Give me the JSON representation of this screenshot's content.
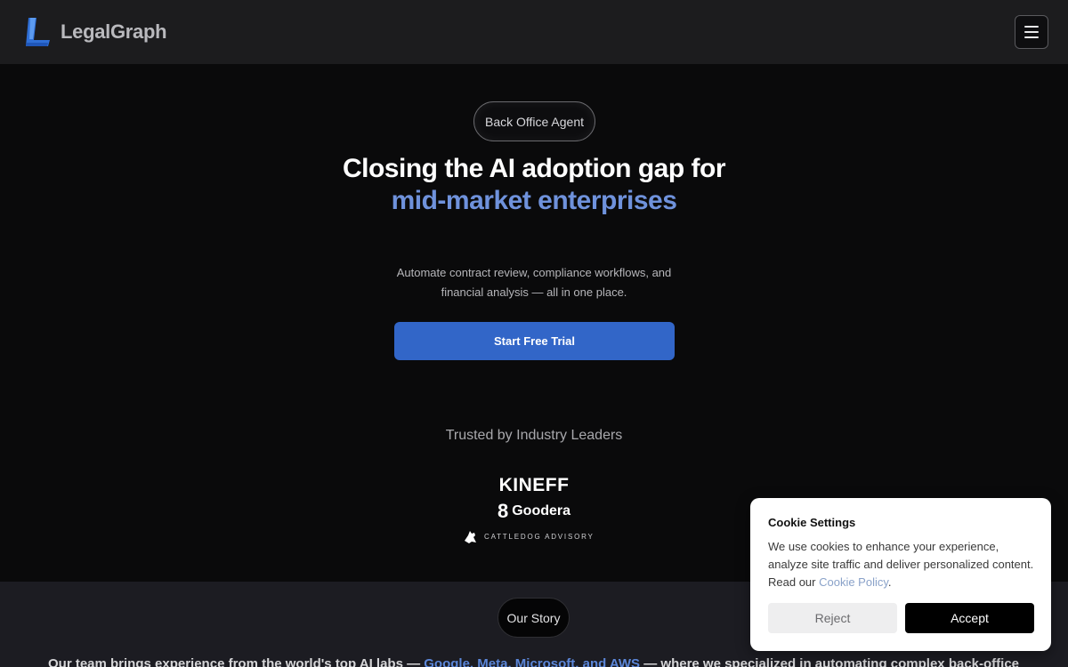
{
  "header": {
    "brand_name": "LegalGraph",
    "logo_icon": "legalgraph-logo-icon",
    "menu_icon": "hamburger-menu-icon"
  },
  "hero": {
    "badge_label": "Back Office Agent",
    "headline_line1": "Closing the AI adoption gap for",
    "headline_line2": "mid-market enterprises",
    "subtext": "Automate contract review, compliance workflows, and financial analysis — all in one place.",
    "cta_label": "Start Free Trial",
    "trusted_heading": "Trusted by Industry Leaders",
    "client_logos": {
      "kineff": "KINEFF",
      "goodera": "Goodera",
      "cattledog": "CATTLEDOG ADVISORY"
    }
  },
  "story": {
    "badge_label": "Our Story",
    "text_before": "Our team brings experience from the world's top AI labs — ",
    "text_link": "Google, Meta, Microsoft, and AWS",
    "text_after": " — where we specialized in automating complex back-office"
  },
  "cookie": {
    "title": "Cookie Settings",
    "body_before": "We use cookies to enhance your experience, analyze site traffic and deliver personalized content. Read our ",
    "policy_link": "Cookie Policy",
    "body_after": ".",
    "reject_label": "Reject",
    "accept_label": "Accept"
  },
  "colors": {
    "accent_blue": "#3266c8",
    "headline_blue": "#6f92dc",
    "background": "#0a0a0b",
    "header_bg": "#1c1c1e"
  }
}
